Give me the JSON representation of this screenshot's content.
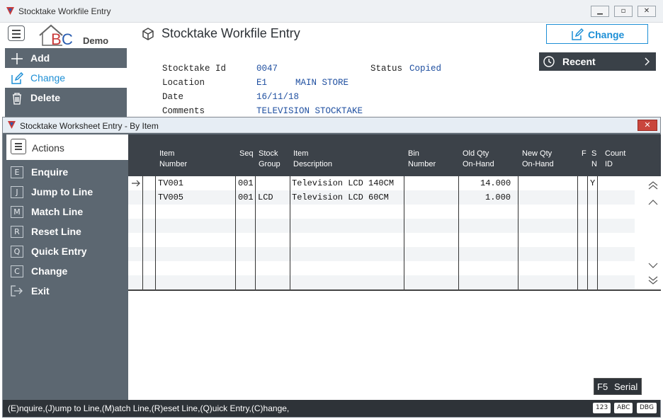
{
  "window": {
    "title": "Stocktake Workfile Entry"
  },
  "brand": {
    "logo_letters": "BC",
    "tag": "Demo"
  },
  "header": {
    "title": "Stocktake Workfile Entry",
    "change_button": "Change"
  },
  "nav": {
    "items": [
      {
        "label": "Add",
        "icon": "plus-icon"
      },
      {
        "label": "Change",
        "icon": "edit-icon",
        "active": true
      },
      {
        "label": "Delete",
        "icon": "trash-icon"
      }
    ]
  },
  "recent": {
    "label": "Recent"
  },
  "record": {
    "stocktake_id_label": "Stocktake Id",
    "stocktake_id": "0047",
    "status_label": "Status",
    "status": "Copied",
    "location_label": "Location",
    "location_code": "E1",
    "location_name": "MAIN STORE",
    "date_label": "Date",
    "date": "16/11/18",
    "comments_label": "Comments",
    "comments": "TELEVISION STOCKTAKE"
  },
  "dialog": {
    "title": "Stocktake Worksheet Entry - By Item",
    "actions_title": "Actions",
    "actions": [
      {
        "key": "E",
        "label": "Enquire"
      },
      {
        "key": "J",
        "label": "Jump to Line"
      },
      {
        "key": "M",
        "label": "Match Line"
      },
      {
        "key": "R",
        "label": "Reset Line"
      },
      {
        "key": "Q",
        "label": "Quick Entry"
      },
      {
        "key": "C",
        "label": "Change"
      },
      {
        "key": "",
        "label": "Exit"
      }
    ],
    "columns": {
      "item_number": [
        "Item",
        "Number"
      ],
      "seq": [
        "",
        "Seq"
      ],
      "stock_group": [
        "Stock",
        "Group"
      ],
      "item_description": [
        "Item",
        "Description"
      ],
      "bin_number": [
        "Bin",
        "Number"
      ],
      "old_qty": [
        "Old Qty",
        "On-Hand"
      ],
      "new_qty": [
        "New Qty",
        "On-Hand"
      ],
      "f": [
        "F",
        ""
      ],
      "sn": [
        "S",
        "N"
      ],
      "count_id": [
        "Count",
        "ID"
      ]
    },
    "rows": [
      {
        "item": "TV001",
        "seq": "001",
        "group": "",
        "desc": "Television LCD 140CM",
        "bin": "",
        "old_qty": "14.000",
        "new_qty": "",
        "f": "",
        "sn": "Y",
        "count_id": ""
      },
      {
        "item": "TV005",
        "seq": "001",
        "group": "LCD",
        "desc": "Television LCD 60CM",
        "bin": "",
        "old_qty": "1.000",
        "new_qty": "",
        "f": "",
        "sn": "",
        "count_id": ""
      }
    ],
    "f5": {
      "key": "F5",
      "label": "Serial"
    },
    "status_text": "(E)nquire,(J)ump to Line,(M)atch Line,(R)eset Line,(Q)uick Entry,(C)hange,",
    "status_pills": [
      "123",
      "ABC",
      "DBG"
    ]
  },
  "colors": {
    "accent": "#1d8fd6",
    "nav_bg": "#5c6771",
    "dark": "#2e3338"
  }
}
